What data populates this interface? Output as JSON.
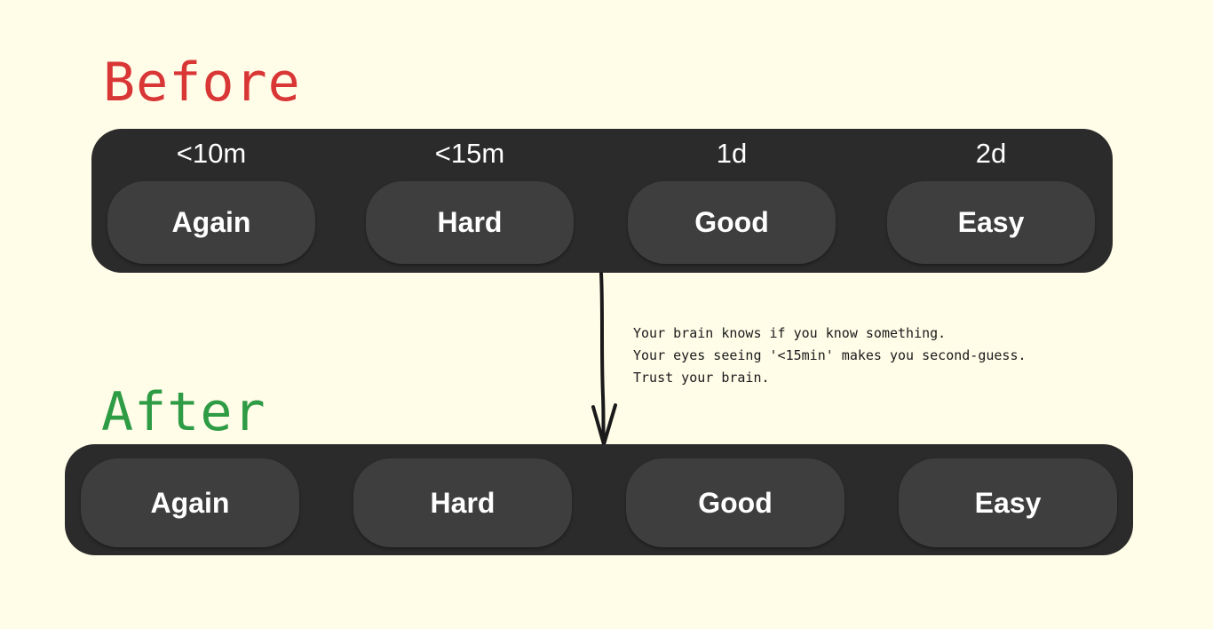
{
  "before": {
    "heading": "Before",
    "heading_color": "#d93636",
    "intervals": [
      "<10m",
      "<15m",
      "1d",
      "2d"
    ],
    "buttons": [
      "Again",
      "Hard",
      "Good",
      "Easy"
    ]
  },
  "after": {
    "heading": "After",
    "heading_color": "#2e9b45",
    "buttons": [
      "Again",
      "Hard",
      "Good",
      "Easy"
    ]
  },
  "caption": {
    "lines": [
      "Your brain knows if you know something.",
      "Your eyes seeing '<15min' makes you second-guess.",
      "Trust your brain."
    ]
  },
  "colors": {
    "background": "#fffce8",
    "bar": "#2b2b2b",
    "button": "#3e3e3e",
    "button_text": "#ffffff",
    "arrow": "#1a1a1a"
  }
}
